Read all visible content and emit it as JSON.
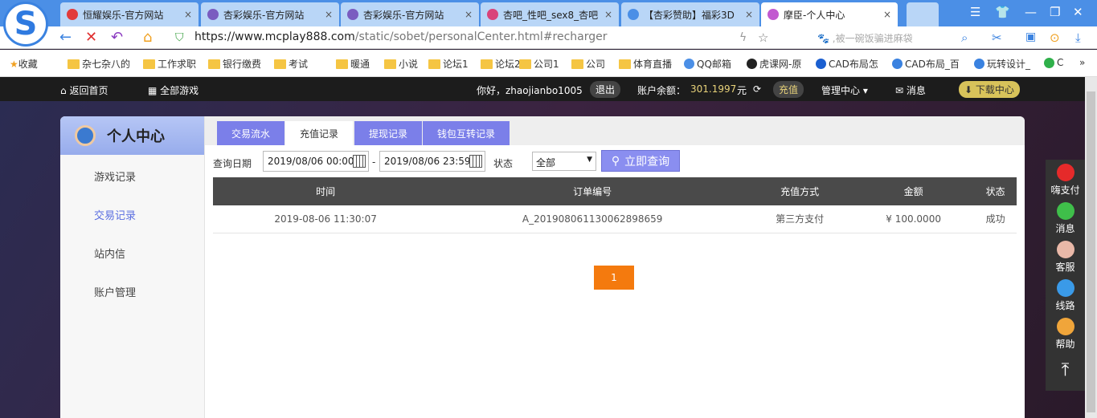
{
  "browser": {
    "tabs": [
      {
        "title": "恒耀娱乐-官方网站",
        "color": "#e23b3b"
      },
      {
        "title": "杏彩娱乐-官方网站",
        "color": "#7a5cc0"
      },
      {
        "title": "杏彩娱乐-官方网站",
        "color": "#7a5cc0"
      },
      {
        "title": "杏吧_性吧_sex8_杏吧",
        "color": "#d9437a"
      },
      {
        "title": "【杏彩赞助】福彩3D",
        "color": "#4b8fe6"
      },
      {
        "title": "摩臣-个人中心",
        "color": "#c25ad0"
      }
    ],
    "close": "×",
    "url_host": "https://www.mcplay888.com",
    "url_path": "/static/sobet/personalCenter.html#recharger",
    "search_placeholder": "被一碗饭骗进麻袋",
    "bookmarks": [
      "收藏",
      "杂七杂八的",
      "工作求职",
      "银行缴费",
      "考试",
      "暖通",
      "小说",
      "论坛1",
      "论坛2",
      "公司1",
      "公司",
      "体育直播",
      "QQ邮箱",
      "虎课网-原",
      "CAD布局怎",
      "CAD布局_百",
      "玩转设计_",
      "C"
    ],
    "more": "»"
  },
  "site": {
    "home": "返回首页",
    "games": "全部游戏",
    "greeting": "你好，zhaojianbo1005",
    "logout": "退出",
    "balance_label": "账户余额：",
    "balance": "301.1997",
    "currency": "元",
    "recharge": "充值",
    "manage": "管理中心",
    "messages": "消息",
    "download": "下载中心"
  },
  "sidebar": {
    "title": "个人中心",
    "items": [
      "游戏记录",
      "交易记录",
      "站内信",
      "账户管理"
    ]
  },
  "tabs": [
    "交易流水",
    "充值记录",
    "提现记录",
    "钱包互转记录"
  ],
  "query": {
    "date_label": "查询日期",
    "from": "2019/08/06 00:00",
    "sep": "-",
    "to": "2019/08/06 23:59",
    "status_label": "状态",
    "status": "全部",
    "button": "立即查询"
  },
  "table": {
    "headers": [
      "时间",
      "订单编号",
      "充值方式",
      "金额",
      "状态"
    ],
    "rows": [
      [
        "2019-08-06 11:30:07",
        "A_20190806113006289865​9",
        "第三方支付",
        "¥ 100.0000",
        "成功"
      ]
    ]
  },
  "pagination": {
    "current": "1"
  },
  "float_menu": [
    "嗨支付",
    "消息",
    "客服",
    "线路",
    "帮助"
  ],
  "colors": {
    "accent": "#7b7fe9",
    "page": "#f47a0e",
    "balance": "#e8d27a"
  }
}
